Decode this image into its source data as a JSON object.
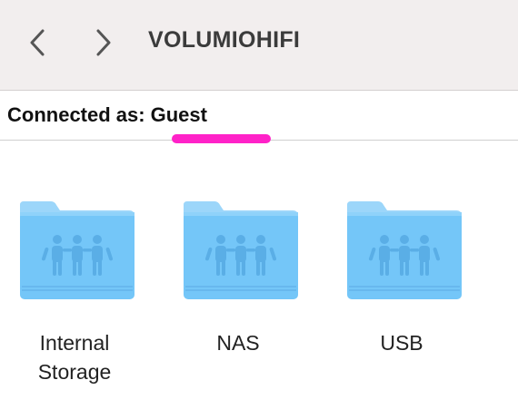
{
  "window": {
    "title": "VOLUMIOHIFI",
    "back_icon": "chevron-left-icon",
    "forward_icon": "chevron-right-icon"
  },
  "connection": {
    "label": "Connected as:",
    "user": "Guest",
    "highlight_color": "#ff22c8"
  },
  "shares": [
    {
      "label": "Internal Storage",
      "icon": "shared-folder-icon"
    },
    {
      "label": "NAS",
      "icon": "shared-folder-icon"
    },
    {
      "label": "USB",
      "icon": "shared-folder-icon"
    }
  ],
  "colors": {
    "folder_body": "#74c6f8",
    "folder_tab": "#9cd6fa",
    "toolbar_bg": "#f2eeee"
  }
}
